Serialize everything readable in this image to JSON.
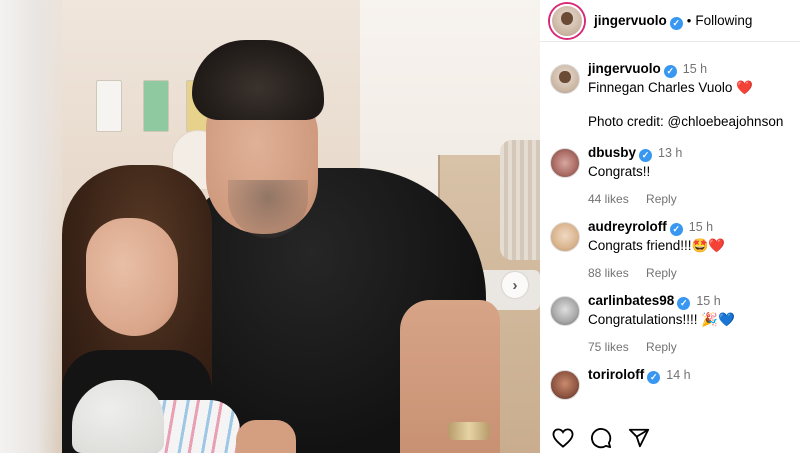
{
  "post": {
    "next_arrow": "›"
  },
  "header": {
    "username": "jingervuolo",
    "separator": "•",
    "follow_state": "Following"
  },
  "comments": [
    {
      "username": "jingervuolo",
      "time": "15 h",
      "text": "Finnegan Charles Vuolo",
      "emoji": "❤️",
      "text2": "Photo credit: @chloebeajohnson"
    },
    {
      "username": "dbusby",
      "time": "13 h",
      "text": "Congrats!!",
      "likes": "44 likes",
      "reply": "Reply"
    },
    {
      "username": "audreyroloff",
      "time": "15 h",
      "text": "Congrats friend!!!",
      "emoji": "🤩❤️",
      "likes": "88 likes",
      "reply": "Reply"
    },
    {
      "username": "carlinbates98",
      "time": "15 h",
      "text": "Congratulations!!!!",
      "emoji": "🎉💙",
      "likes": "75 likes",
      "reply": "Reply"
    },
    {
      "username": "toriroloff",
      "time": "14 h"
    }
  ],
  "colors": {
    "verified": "#3897f0",
    "meta_gray": "#737373"
  }
}
